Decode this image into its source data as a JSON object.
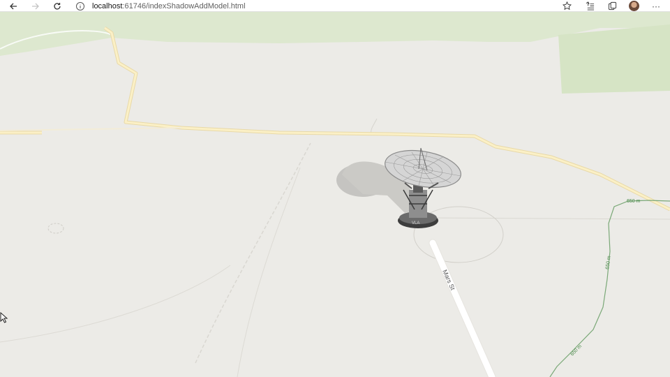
{
  "browser": {
    "back_icon": "arrow-left-icon",
    "forward_icon": "arrow-right-icon",
    "refresh_icon": "refresh-icon",
    "address_host": "localhost",
    "address_path": ":61746/indexShadowAddModel.html",
    "favorite_icon": "star-icon",
    "collections_icon": "reading-list-icon",
    "tabs_icon": "collections-icon",
    "profile_icon": "avatar-icon",
    "more_icon": "more-icon",
    "more_glyph": "···"
  },
  "map": {
    "street_label": "Mars St",
    "contour_labels": [
      "650 m",
      "650 m",
      "650 m"
    ],
    "model_label": "VLA",
    "colors": {
      "land": "#ecebe7",
      "park": "#d8e6c8",
      "major_road": "#fbeec1",
      "road_outline": "#e8d9a8",
      "minor_road": "#ffffff",
      "contour": "#5a9a5a"
    }
  }
}
